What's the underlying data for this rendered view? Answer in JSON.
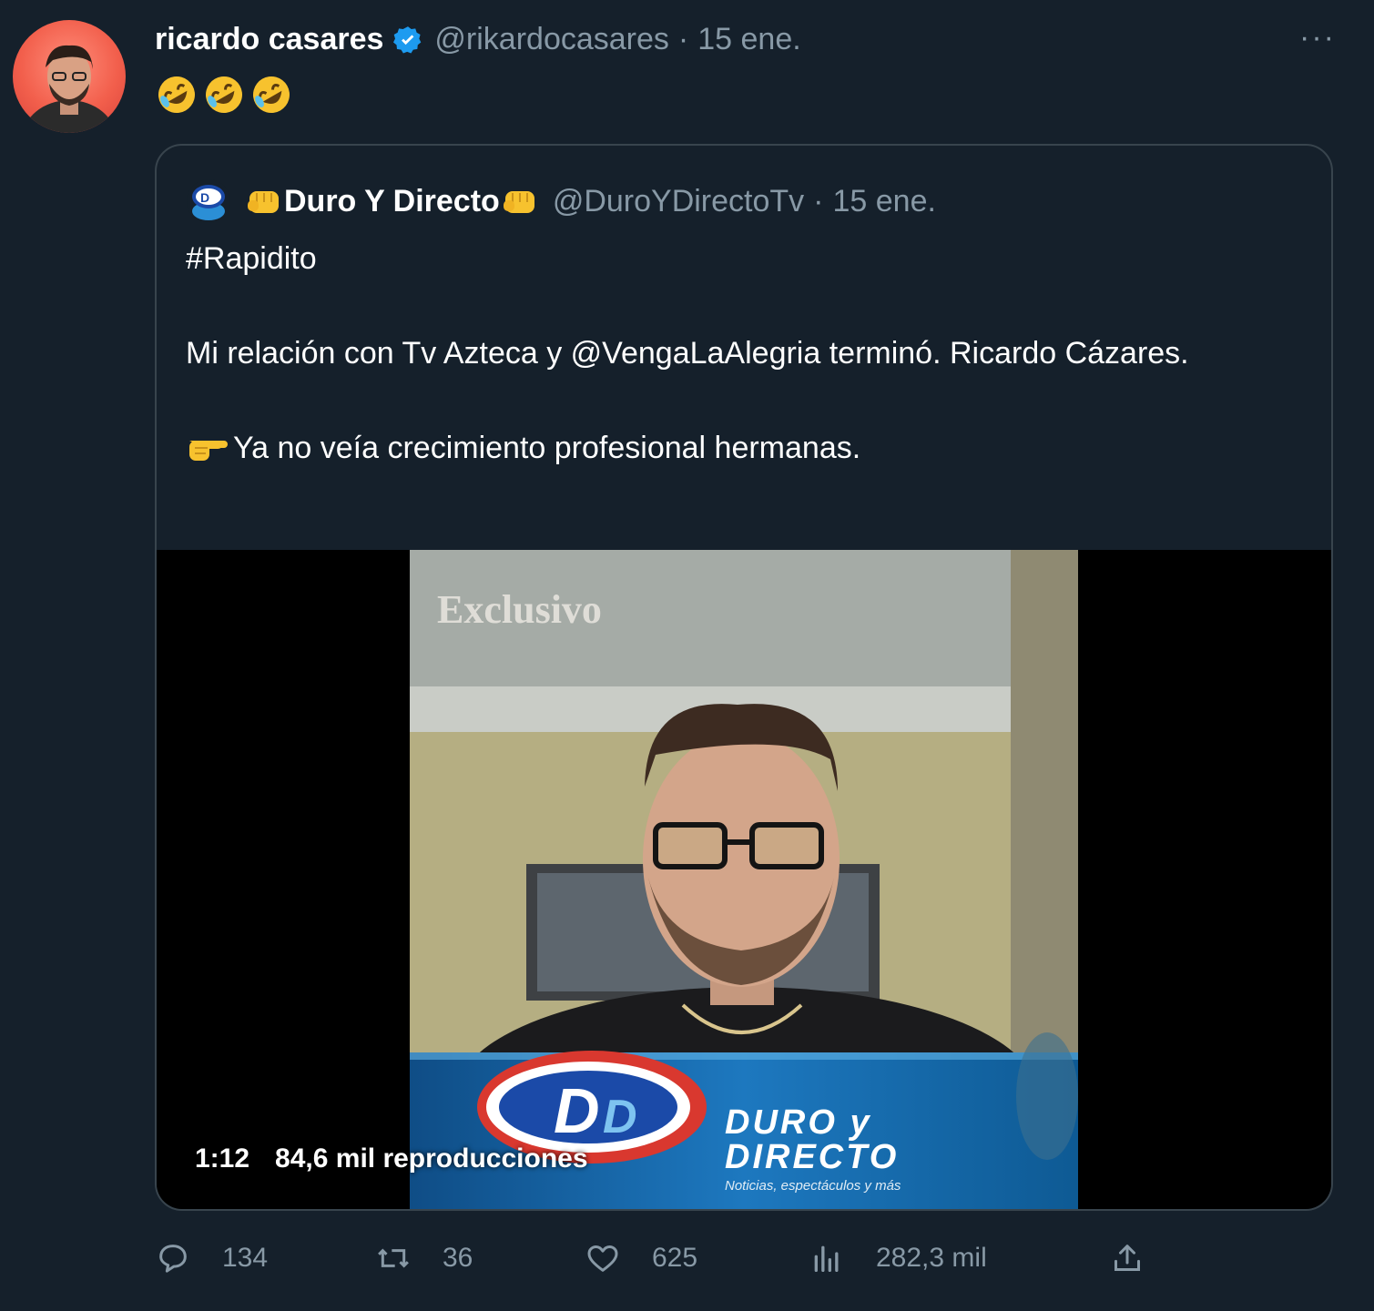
{
  "tweet": {
    "author_name": "ricardo casares",
    "handle": "@rikardocasares",
    "separator": "·",
    "date": "15 ene.",
    "more_label": "···",
    "emojis": [
      "rofl-emoji",
      "rofl-emoji",
      "rofl-emoji"
    ]
  },
  "quoted": {
    "author_name": "Duro Y Directo",
    "handle": "@DuroYDirectoTv",
    "separator": "·",
    "date": "15 ene.",
    "hashtag": "#Rapidito",
    "text_line1": "Mi relación con Tv Azteca y @VengaLaAlegria terminó. Ricardo Cázares.",
    "text_line2": "Ya no veía crecimiento profesional hermanas.",
    "video": {
      "overlay_label": "Exclusivo",
      "banner_title_1": "DURO y",
      "banner_title_2": "DIRECTO",
      "banner_subtitle": "Noticias, espectáculos y más",
      "duration": "1:12",
      "views": "84,6 mil reproducciones"
    }
  },
  "actions": {
    "reply_count": "134",
    "retweet_count": "36",
    "like_count": "625",
    "views_count": "282,3 mil"
  },
  "colors": {
    "background": "#15202b",
    "border": "#38444d",
    "secondary_text": "#8899a6",
    "verified_blue": "#1d9bf0"
  }
}
